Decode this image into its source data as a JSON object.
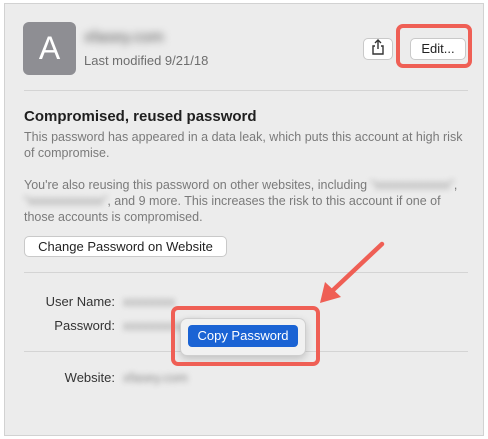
{
  "account": {
    "avatar_letter": "A",
    "site_name": "xfasey.com",
    "last_modified": "Last modified 9/21/18"
  },
  "toolbar": {
    "share_icon": "share-icon",
    "edit_label": "Edit..."
  },
  "warning": {
    "title": "Compromised, reused password",
    "line1": "This password has appeared in a data leak, which puts this account at high risk of compromise.",
    "reuse_prefix": "You're also reusing this password on other websites, including",
    "reuse_site1": "“xxxxxxxxxxxx”",
    "reuse_sep": ", ",
    "reuse_site2": "“xxxxxxxxxxxx”",
    "reuse_suffix": ", and 9 more. This increases the risk to this account if one of those accounts is compromised.",
    "change_button": "Change Password on Website"
  },
  "fields": {
    "username_label": "User Name:",
    "username_value": "xxxxxxxx",
    "password_label": "Password:",
    "password_value": "xxxxxxxxxx01",
    "website_label": "Website:",
    "website_value": "xfasey.com"
  },
  "context_menu": {
    "copy_password": "Copy Password"
  },
  "annotations": {
    "highlight_color": "#ef5f55",
    "menu_accent": "#1a63d4"
  }
}
